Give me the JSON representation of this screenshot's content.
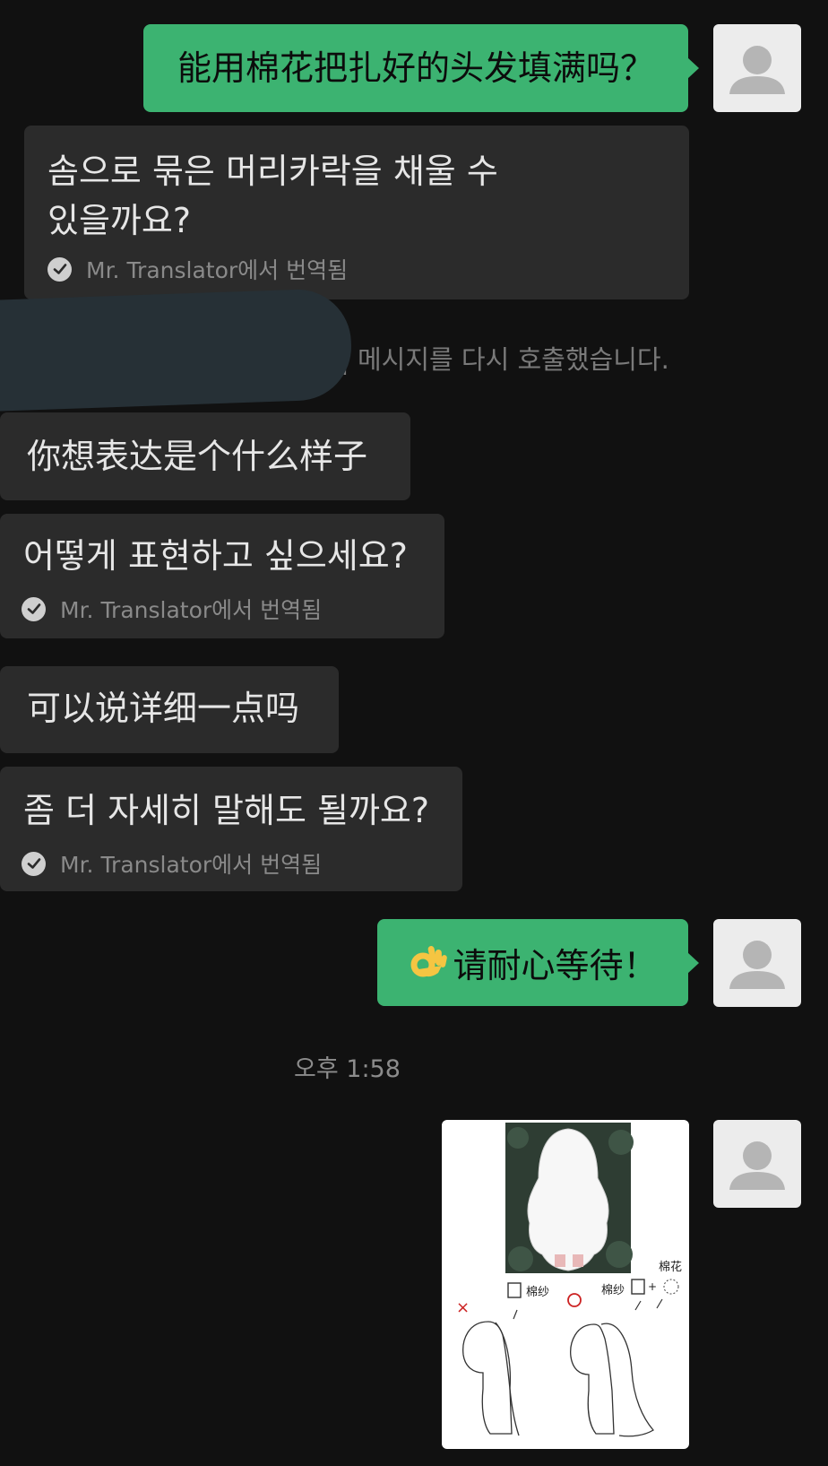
{
  "messages": {
    "m1": {
      "text": "能用棉花把扎好的头发填满吗？"
    },
    "m1_translation": {
      "line1": "솜으로 묶은 머리카락을 채울 수",
      "line2": "있을까요?",
      "source": "Mr. Translator에서 번역됨"
    },
    "recall": {
      "text": "| 메시지를 다시 호출했습니다."
    },
    "m2": {
      "text": "你想表达是个什么样子"
    },
    "m2_translation": {
      "text": "어떻게 표현하고 싶으세요?",
      "source": "Mr. Translator에서 번역됨"
    },
    "m3": {
      "text": "可以说详细一点吗"
    },
    "m3_translation": {
      "text": "좀 더 자세히 말해도 될까요?",
      "source": "Mr. Translator에서 번역됨"
    },
    "m4": {
      "text": "请耐心等待！"
    },
    "timestamp": "오후 1:58",
    "image_labels": {
      "left_label": "棉纱",
      "right_label": "棉纱",
      "cotton_label": "棉花"
    }
  },
  "icons": {
    "avatar": "default-user-icon",
    "check": "check-circle-icon",
    "ok_hand": "ok-hand-emoji"
  },
  "colors": {
    "background": "#111111",
    "sent_bubble": "#3cb371",
    "received_bubble": "#2b2b2b",
    "avatar_bg": "#ececec"
  }
}
